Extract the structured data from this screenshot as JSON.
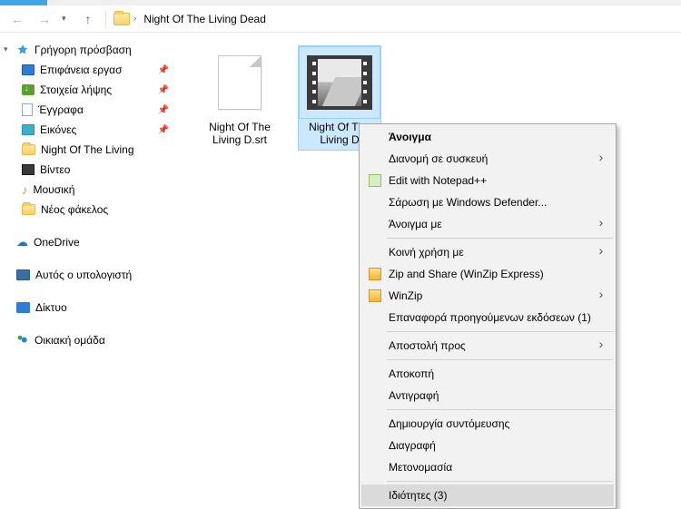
{
  "breadcrumb": {
    "folder_name": "Night Of The Living Dead"
  },
  "sidebar": {
    "quick_access": "Γρήγορη πρόσβαση",
    "items": [
      {
        "label": "Επιφάνεια εργασ",
        "icon": "desktop",
        "pinned": true
      },
      {
        "label": "Στοιχεία λήψης",
        "icon": "downloads",
        "pinned": true
      },
      {
        "label": "Έγγραφα",
        "icon": "documents",
        "pinned": true
      },
      {
        "label": "Εικόνες",
        "icon": "pictures",
        "pinned": true
      },
      {
        "label": "Night Of The Living",
        "icon": "folder",
        "pinned": false
      },
      {
        "label": "Βίντεο",
        "icon": "videos",
        "pinned": false
      },
      {
        "label": "Μουσική",
        "icon": "music",
        "pinned": false
      },
      {
        "label": "Νέος φάκελος",
        "icon": "folder",
        "pinned": false
      }
    ],
    "onedrive": "OneDrive",
    "this_pc": "Αυτός ο υπολογιστή",
    "network": "Δίκτυο",
    "homegroup": "Οικιακή ομάδα"
  },
  "files": [
    {
      "name": "Night Of The Living D.srt",
      "kind": "subtitle",
      "selected": false
    },
    {
      "name": "Night Of The Living D",
      "kind": "video",
      "selected": true
    }
  ],
  "context_menu": {
    "open": "Άνοιγμα",
    "cast": "Διανομή σε συσκευή",
    "edit_npp": "Edit with Notepad++",
    "scan_defender": "Σάρωση με Windows Defender...",
    "open_with": "Άνοιγμα με",
    "share_with": "Κοινή χρήση με",
    "zip_share": "Zip and Share (WinZip Express)",
    "winzip": "WinZip",
    "restore_prev": "Επαναφορά προηγούμενων εκδόσεων (1)",
    "send_to": "Αποστολή προς",
    "cut": "Αποκοπή",
    "copy": "Αντιγραφή",
    "create_shortcut": "Δημιουργία συντόμευσης",
    "delete": "Διαγραφή",
    "rename": "Μετονομασία",
    "properties": "Ιδιότητες (3)"
  }
}
